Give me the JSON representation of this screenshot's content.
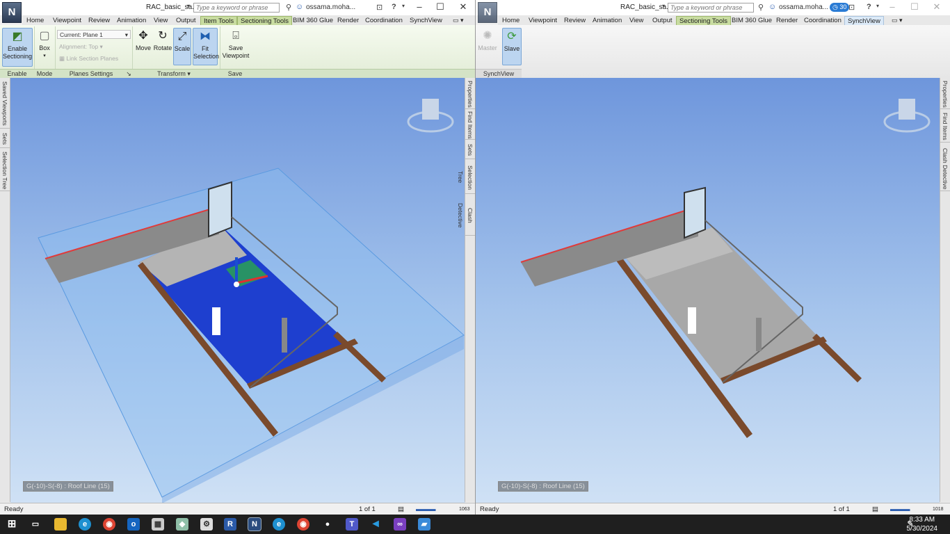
{
  "left": {
    "app_logo": "N",
    "doc_title": "RAC_basic_sa...",
    "search_placeholder": "Type a keyword or phrase",
    "user": "ossama.moha...",
    "tabs": [
      "Home",
      "Viewpoint",
      "Review",
      "Animation",
      "View",
      "Output",
      "Item Tools",
      "Sectioning Tools",
      "BIM 360 Glue",
      "Render",
      "Coordination",
      "SynchView"
    ],
    "ribbon": {
      "enable_sectioning": "Enable Sectioning",
      "box": "Box",
      "current_plane": "Current: Plane 1",
      "alignment": "Alignment: Top",
      "link_section_planes": "Link Section Planes",
      "move": "Move",
      "rotate": "Rotate",
      "scale": "Scale",
      "fit_selection": "Fit Selection",
      "save_viewpoint": "Save Viewpoint",
      "groups": [
        "Enable",
        "Mode",
        "Planes Settings",
        "Transform",
        "Save"
      ]
    },
    "left_panels": [
      "Saved Viewports",
      "Sets",
      "Selection Tree"
    ],
    "right_panels": [
      "Properties",
      "Find Items",
      "Sets",
      "Selection Tree",
      "Clash Detective"
    ],
    "coord_readout": "G(-10)-S(-8) : Roof Line (15)",
    "status": {
      "ready": "Ready",
      "page": "1 of 1",
      "mem": "1063"
    }
  },
  "right": {
    "app_logo": "N",
    "doc_title": "RAC_basic_sa...",
    "search_placeholder": "Type a keyword or phrase",
    "user": "ossama.moha...",
    "badge": "30",
    "tabs": [
      "Home",
      "Viewpoint",
      "Review",
      "Animation",
      "View",
      "Output",
      "Sectioning Tools",
      "BIM 360 Glue",
      "Render",
      "Coordination",
      "SynchView"
    ],
    "ribbon": {
      "master": "Master",
      "slave": "Slave",
      "group": "SynchView"
    },
    "right_panels": [
      "Properties",
      "Find Items",
      "Clash Detective"
    ],
    "coord_readout": "G(-10)-S(-8) : Roof Line (15)",
    "status": {
      "ready": "Ready",
      "page": "1 of 1",
      "mem": "1018"
    }
  },
  "clock": {
    "time": "8:33 AM",
    "date": "5/30/2024"
  }
}
